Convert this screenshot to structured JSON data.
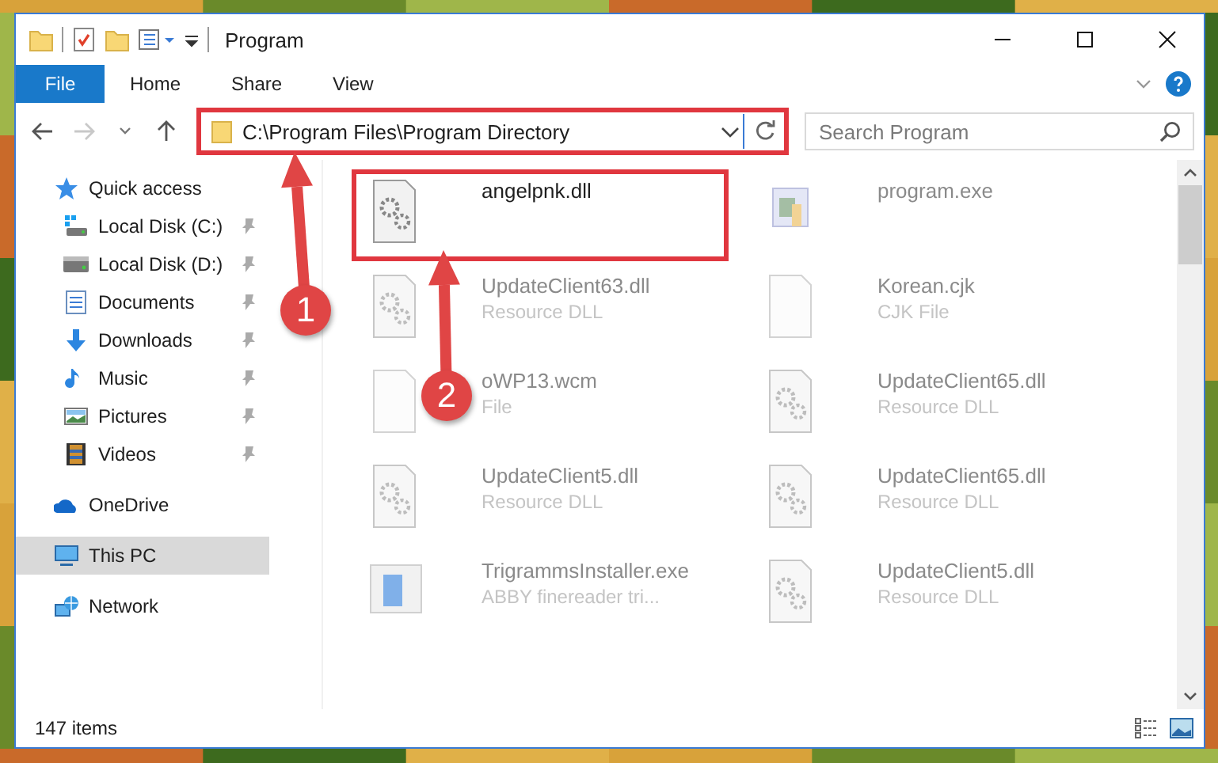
{
  "window": {
    "title": "Program"
  },
  "ribbon": {
    "tabs": [
      {
        "label": "File",
        "selected": true
      },
      {
        "label": "Home",
        "selected": false
      },
      {
        "label": "Share",
        "selected": false
      },
      {
        "label": "View",
        "selected": false
      }
    ]
  },
  "address_bar": {
    "path": "C:\\Program Files\\Program Directory",
    "highlighted": true,
    "forward_disabled": true
  },
  "search": {
    "placeholder": "Search Program"
  },
  "sidebar": {
    "items": [
      {
        "label": "Quick access",
        "selected": false,
        "children": [
          {
            "label": "Local Disk (C:)",
            "pinned": true,
            "selected": false
          },
          {
            "label": "Local Disk (D:)",
            "pinned": true,
            "selected": false
          },
          {
            "label": "Documents",
            "pinned": true,
            "selected": false
          },
          {
            "label": "Downloads",
            "pinned": true,
            "selected": false
          },
          {
            "label": "Music",
            "pinned": true,
            "selected": false
          },
          {
            "label": "Pictures",
            "pinned": true,
            "selected": false
          },
          {
            "label": "Videos",
            "pinned": true,
            "selected": false
          }
        ]
      },
      {
        "label": "OneDrive",
        "selected": false
      },
      {
        "label": "This PC",
        "selected": true
      },
      {
        "label": "Network",
        "selected": false
      }
    ]
  },
  "files": [
    {
      "name": "angelpnk.dll",
      "kind": "dll",
      "blurred": false,
      "highlighted": true
    },
    {
      "name": "program.exe",
      "kind": "exe",
      "blurred": true,
      "highlighted": false
    },
    {
      "name": "UpdateClient63.dll",
      "type": "Resource DLL",
      "kind": "dll",
      "blurred": true,
      "highlighted": false
    },
    {
      "name": "Korean.cjk",
      "type": "CJK File",
      "kind": "file",
      "blurred": true,
      "highlighted": false
    },
    {
      "name": "oWP13.wcm",
      "type": "File",
      "kind": "file",
      "blurred": true,
      "highlighted": false
    },
    {
      "name": "UpdateClient65.dll",
      "type": "Resource DLL",
      "kind": "dll",
      "blurred": true,
      "highlighted": false
    },
    {
      "name": "UpdateClient5.dll",
      "type": "Resource DLL",
      "kind": "dll",
      "blurred": true,
      "highlighted": false
    },
    {
      "name": "UpdateClient65.dll",
      "type": "Resource DLL",
      "kind": "dll",
      "blurred": true,
      "highlighted": false
    },
    {
      "name": "TrigrammsInstaller.exe",
      "type": "ABBY finereader tri...",
      "kind": "installer",
      "blurred": true,
      "highlighted": false
    },
    {
      "name": "UpdateClient5.dll",
      "type": "Resource DLL",
      "kind": "dll",
      "blurred": true,
      "highlighted": false
    }
  ],
  "status_bar": {
    "count": "147 items"
  },
  "annotations": [
    {
      "label": "1"
    },
    {
      "label": "2"
    }
  ]
}
